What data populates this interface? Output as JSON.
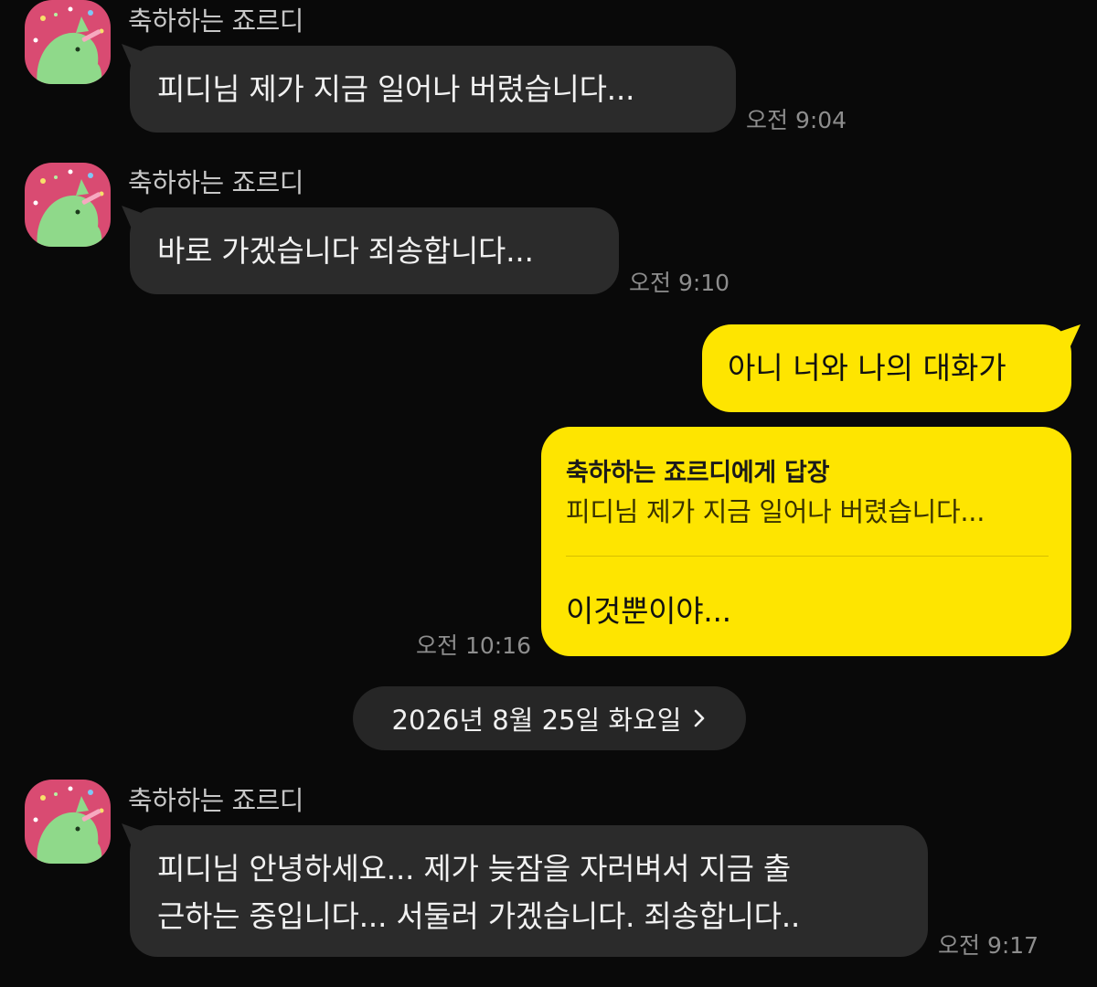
{
  "messages": [
    {
      "sender": "축하하는 죠르디",
      "text": "피디님 제가 지금 일어나 버렸습니다...",
      "time": "오전 9:04"
    },
    {
      "sender": "축하하는 죠르디",
      "text": "바로 가겠습니다 죄송합니다...",
      "time": "오전 9:10"
    },
    {
      "sender": "me",
      "text": "아니 너와 나의 대화가"
    },
    {
      "sender": "me",
      "reply_header": "축하하는 죠르디에게 답장",
      "reply_quote": "피디님 제가 지금 일어나 버렸습니다...",
      "text": "이것뿐이야...",
      "time": "오전 10:16"
    },
    {
      "sender": "축하하는 죠르디",
      "text_lines": [
        "피디님 안녕하세요... 제가 늦잠을 자러벼서 지금 출",
        "근하는 중입니다... 서둘러 가겠습니다. 죄송합니다.."
      ],
      "time": "오전 9:17"
    }
  ],
  "date_divider": {
    "label": "2026년 8월 25일 화요일",
    "icon": "chevron-right-icon"
  },
  "colors": {
    "background": "#090909",
    "incoming_bubble": "#2b2b2b",
    "outgoing_bubble": "#fee500",
    "avatar_bg": "#d94b72",
    "avatar_character": "#8fd98a"
  },
  "avatar_icon": "jordy-character-avatar"
}
